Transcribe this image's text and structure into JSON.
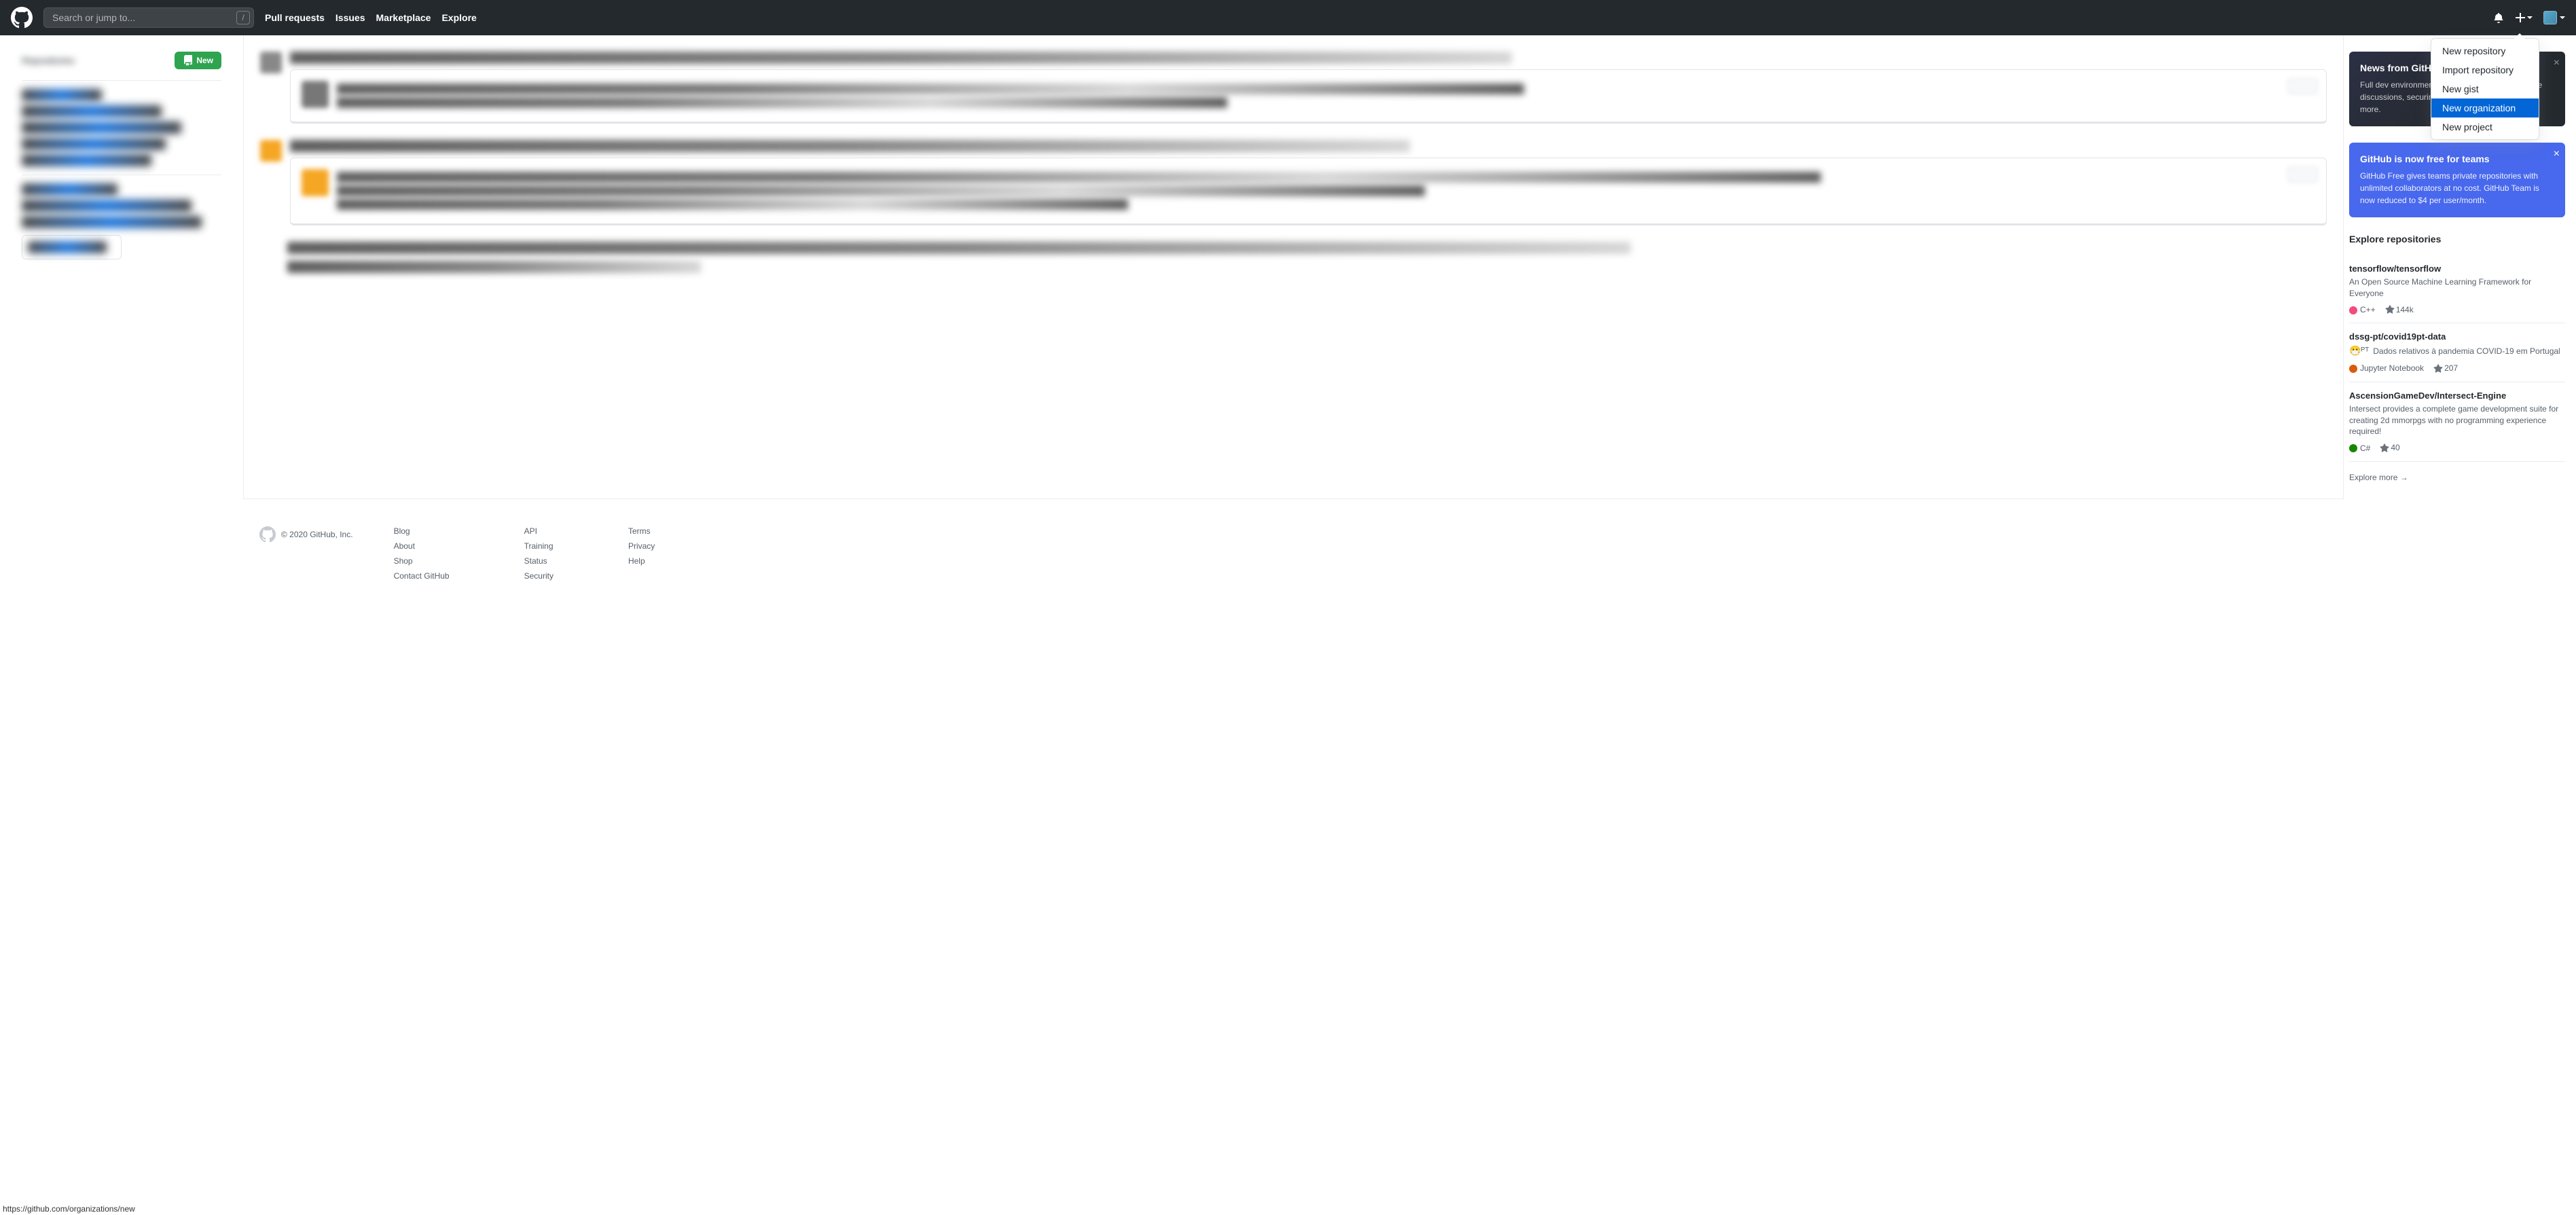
{
  "header": {
    "search_placeholder": "Search or jump to...",
    "slash_key": "/",
    "nav": [
      "Pull requests",
      "Issues",
      "Marketplace",
      "Explore"
    ]
  },
  "plus_menu": {
    "items": [
      "New repository",
      "Import repository",
      "New gist",
      "New organization",
      "New project"
    ],
    "highlighted_index": 3
  },
  "sidebar_left": {
    "new_button": "New"
  },
  "notices": {
    "news": {
      "title": "News from GitHub",
      "body": "Full dev environments in Code, a new way to have discussions, securing projects with scanning, and more."
    },
    "teams": {
      "title": "GitHub is now free for teams",
      "body": "GitHub Free gives teams private repositories with unlimited collaborators at no cost. GitHub Team is now reduced to $4 per user/month."
    }
  },
  "explore": {
    "title": "Explore repositories",
    "repos": [
      {
        "name": "tensorflow/tensorflow",
        "desc": "An Open Source Machine Learning Framework for Everyone",
        "lang": "C++",
        "lang_color": "#f34b7d",
        "stars": "144k",
        "emoji": ""
      },
      {
        "name": "dssg-pt/covid19pt-data",
        "desc": "Dados relativos à pandemia COVID-19 em Portugal",
        "lang": "Jupyter Notebook",
        "lang_color": "#DA5B0B",
        "stars": "207",
        "emoji": "😷ᴾᵀ "
      },
      {
        "name": "AscensionGameDev/Intersect-Engine",
        "desc": "Intersect provides a complete game development suite for creating 2d mmorpgs with no programming experience required!",
        "lang": "C#",
        "lang_color": "#178600",
        "stars": "40",
        "emoji": ""
      }
    ],
    "more": "Explore more →"
  },
  "footer": {
    "copyright": "© 2020 GitHub, Inc.",
    "cols": [
      [
        "Blog",
        "About",
        "Shop",
        "Contact GitHub"
      ],
      [
        "API",
        "Training",
        "Status",
        "Security"
      ],
      [
        "Terms",
        "Privacy",
        "Help"
      ]
    ]
  },
  "status_url": "https://github.com/organizations/new"
}
